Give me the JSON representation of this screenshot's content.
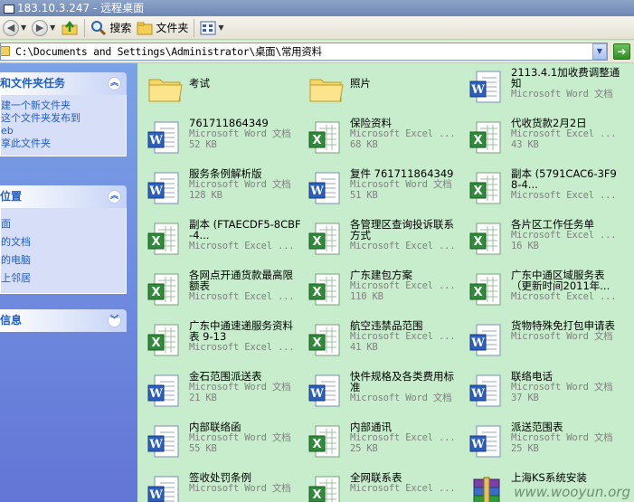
{
  "window": {
    "title": "183.10.3.247 - 远程桌面"
  },
  "toolbar": {
    "search_label": "搜索",
    "folders_label": "文件夹"
  },
  "address": {
    "path": "C:\\Documents and Settings\\Administrator\\桌面\\常用资料"
  },
  "sidebar": {
    "panels": [
      {
        "title": "和文件夹任务",
        "toggle": "︽",
        "items": [
          "建一个新文件夹",
          "这个文件夹发布到",
          "eb",
          "享此文件夹"
        ]
      },
      {
        "title": "位置",
        "toggle": "︽",
        "items": [
          "面",
          "的文档",
          "的电脑",
          "上邻居"
        ]
      },
      {
        "title": "信息",
        "toggle": "︾",
        "items": []
      }
    ]
  },
  "files": [
    {
      "kind": "folder",
      "name": "考试",
      "type": "",
      "size": ""
    },
    {
      "kind": "folder",
      "name": "照片",
      "type": "",
      "size": ""
    },
    {
      "kind": "word",
      "name": "2113.4.1加收费调整通知",
      "type": "Microsoft Word 文档",
      "size": ""
    },
    {
      "kind": "word",
      "name": "761711864349",
      "type": "Microsoft Word 文档",
      "size": "52 KB"
    },
    {
      "kind": "excel",
      "name": "保险资料",
      "type": "Microsoft Excel ...",
      "size": "68 KB"
    },
    {
      "kind": "excel",
      "name": "代收货款2月2日",
      "type": "Microsoft Excel ...",
      "size": "43 KB"
    },
    {
      "kind": "word",
      "name": "服务条例解析版",
      "type": "Microsoft Word 文档",
      "size": "128 KB"
    },
    {
      "kind": "word",
      "name": "复件 761711864349",
      "type": "Microsoft Word 文档",
      "size": "51 KB"
    },
    {
      "kind": "excel",
      "name": "副本 (5791CAC6-3F98-4...",
      "type": "Microsoft Excel ...",
      "size": ""
    },
    {
      "kind": "excel",
      "name": "副本 (FTAECDF5-8CBF-4...",
      "type": "Microsoft Excel ...",
      "size": ""
    },
    {
      "kind": "excel",
      "name": "各管理区查询投诉联系方式",
      "type": "Microsoft Excel ...",
      "size": ""
    },
    {
      "kind": "excel",
      "name": "各片区工作任务单",
      "type": "Microsoft Excel ...",
      "size": "16 KB"
    },
    {
      "kind": "excel",
      "name": "各网点开通货款最高限额表",
      "type": "Microsoft Excel ...",
      "size": ""
    },
    {
      "kind": "excel",
      "name": "广东建包方案",
      "type": "Microsoft Excel ...",
      "size": "110 KB"
    },
    {
      "kind": "excel",
      "name": "广东中通区域服务表（更新时间2011年...",
      "type": "Microsoft Excel ...",
      "size": ""
    },
    {
      "kind": "excel",
      "name": "广东中通速递服务资料表 9-13",
      "type": "Microsoft Excel ...",
      "size": ""
    },
    {
      "kind": "excel",
      "name": "航空违禁品范围",
      "type": "Microsoft Excel ...",
      "size": "41 KB"
    },
    {
      "kind": "word",
      "name": "货物特殊免打包申请表",
      "type": "Microsoft Word 文档",
      "size": ""
    },
    {
      "kind": "word",
      "name": "金石范围派送表",
      "type": "Microsoft Word 文档",
      "size": "21 KB"
    },
    {
      "kind": "word",
      "name": "快件规格及各类费用标准",
      "type": "Microsoft Word 文档",
      "size": ""
    },
    {
      "kind": "word",
      "name": "联络电话",
      "type": "Microsoft Word 文档",
      "size": "37 KB"
    },
    {
      "kind": "word",
      "name": "内部联络函",
      "type": "Microsoft Word 文档",
      "size": "55 KB"
    },
    {
      "kind": "excel",
      "name": "内部通讯",
      "type": "Microsoft Excel ...",
      "size": "25 KB"
    },
    {
      "kind": "word",
      "name": "派送范围表",
      "type": "Microsoft Word 文档",
      "size": "25 KB"
    },
    {
      "kind": "word",
      "name": "签收处罚条例",
      "type": "Microsoft Word 文档",
      "size": ""
    },
    {
      "kind": "excel",
      "name": "全网联系表",
      "type": "Microsoft Excel ...",
      "size": ""
    },
    {
      "kind": "rar",
      "name": "上海KS系统安装",
      "type": "",
      "size": ""
    }
  ],
  "watermark": "www.wooyun.org"
}
